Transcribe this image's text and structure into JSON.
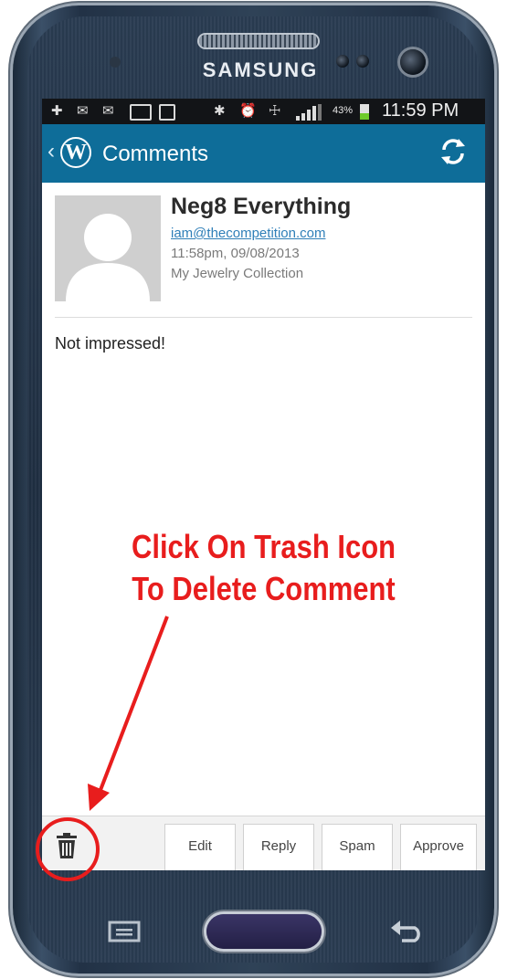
{
  "device": {
    "brand": "SAMSUNG"
  },
  "status_bar": {
    "icons": [
      "plus-icon",
      "mail-icon",
      "mail-icon",
      "calendar-icon",
      "screen-share-icon",
      "bluetooth-icon",
      "alarm-icon",
      "wifi-icon",
      "signal-icon"
    ],
    "battery_percent": "43%",
    "battery_level": 0.43,
    "time": "11:59 PM"
  },
  "action_bar": {
    "logo_letter": "W",
    "title": "Comments",
    "color": "#0e6d99"
  },
  "comment": {
    "author": "Neg8 Everything",
    "email": "iam@thecompetition.com",
    "date": "11:58pm, 09/08/2013",
    "post": "My Jewelry Collection",
    "body": "Not impressed!"
  },
  "annotation": {
    "line1": "Click On Trash Icon",
    "line2": "To Delete Comment",
    "color": "#e81d1d"
  },
  "actions": {
    "edit": "Edit",
    "reply": "Reply",
    "spam": "Spam",
    "approve": "Approve"
  }
}
